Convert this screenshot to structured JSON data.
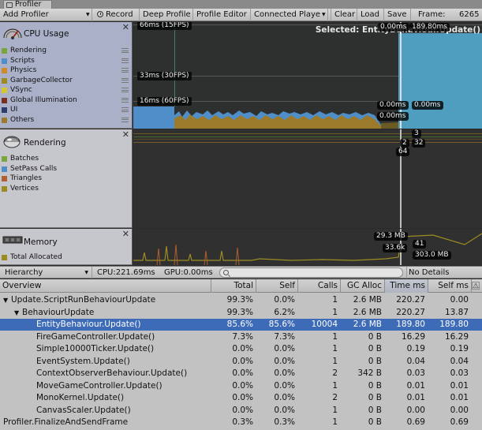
{
  "window": {
    "tab_title": "Profiler"
  },
  "toolbar": {
    "add_profiler": "Add Profiler",
    "record": "Record",
    "deep_profile": "Deep Profile",
    "profile_editor": "Profile Editor",
    "connected_player": "Connected Playe",
    "clear": "Clear",
    "load": "Load",
    "save": "Save",
    "frame_label": "Frame:",
    "frame_value": "6265"
  },
  "cpu_panel": {
    "title": "CPU Usage",
    "icon": "cpu-gauge-icon",
    "items": [
      {
        "label": "Rendering",
        "color": "#7aa53b"
      },
      {
        "label": "Scripts",
        "color": "#4f8ec8"
      },
      {
        "label": "Physics",
        "color": "#d08a2a"
      },
      {
        "label": "GarbageCollector",
        "color": "#9c8c1f"
      },
      {
        "label": "VSync",
        "color": "#d5c52e"
      },
      {
        "label": "Global Illumination",
        "color": "#7a2e1f"
      },
      {
        "label": "UI",
        "color": "#2b3e6b"
      },
      {
        "label": "Others",
        "color": "#9c7a2c"
      }
    ],
    "fps_labels": [
      "66ms (15FPS)",
      "33ms (30FPS)",
      "16ms (60FPS)"
    ],
    "selected_text": "Selected: EntityBehaviour.Update()",
    "value_labels": [
      "0.00ms",
      "189.80ms",
      "0.00ms",
      "0.00ms",
      "0.00ms"
    ]
  },
  "render_panel": {
    "title": "Rendering",
    "icon": "rendering-teapot-icon",
    "items": [
      {
        "label": "Batches",
        "color": "#7aa53b"
      },
      {
        "label": "SetPass Calls",
        "color": "#4f8ec8"
      },
      {
        "label": "Triangles",
        "color": "#b06030"
      },
      {
        "label": "Vertices",
        "color": "#9c8c1f"
      }
    ],
    "value_labels": [
      "3",
      "2",
      "32",
      "64"
    ]
  },
  "memory_panel": {
    "title": "Memory",
    "icon": "memory-chip-icon",
    "items": [
      {
        "label": "Total Allocated",
        "color": "#9c8c1f"
      }
    ],
    "value_labels": [
      "29.3 MB",
      "41",
      "33.6k",
      "303.0 MB"
    ]
  },
  "detail_bar": {
    "view_mode": "Hierarchy",
    "cpu_time": "CPU:221.69ms",
    "gpu_time": "GPU:0.00ms",
    "search_value": "",
    "details_mode": "No Details"
  },
  "table": {
    "columns": [
      "Overview",
      "Total",
      "Self",
      "Calls",
      "GC Alloc",
      "Time ms",
      "Self ms"
    ],
    "sorted_column": "Time ms",
    "rows": [
      {
        "arrow": "▼",
        "name": "Update.ScriptRunBehaviourUpdate",
        "total": "99.3%",
        "self": "0.0%",
        "calls": "1",
        "gc": "2.6 MB",
        "time": "220.27",
        "selfms": "0.00"
      },
      {
        "arrow": "▼",
        "name": "BehaviourUpdate",
        "total": "99.3%",
        "self": "6.2%",
        "calls": "1",
        "gc": "2.6 MB",
        "time": "220.27",
        "selfms": "13.87"
      },
      {
        "arrow": "",
        "name": "EntityBehaviour.Update()",
        "total": "85.6%",
        "self": "85.6%",
        "calls": "10004",
        "gc": "2.6 MB",
        "time": "189.80",
        "selfms": "189.80",
        "selected": true
      },
      {
        "arrow": "",
        "name": "FireGameController.Update()",
        "total": "7.3%",
        "self": "7.3%",
        "calls": "1",
        "gc": "0 B",
        "time": "16.29",
        "selfms": "16.29"
      },
      {
        "arrow": "",
        "name": "Simple10000Ticker.Update()",
        "total": "0.0%",
        "self": "0.0%",
        "calls": "1",
        "gc": "0 B",
        "time": "0.19",
        "selfms": "0.19"
      },
      {
        "arrow": "",
        "name": "EventSystem.Update()",
        "total": "0.0%",
        "self": "0.0%",
        "calls": "1",
        "gc": "0 B",
        "time": "0.04",
        "selfms": "0.04"
      },
      {
        "arrow": "",
        "name": "ContextObserverBehaviour.Update()",
        "total": "0.0%",
        "self": "0.0%",
        "calls": "2",
        "gc": "342 B",
        "time": "0.03",
        "selfms": "0.03"
      },
      {
        "arrow": "",
        "name": "MoveGameController.Update()",
        "total": "0.0%",
        "self": "0.0%",
        "calls": "1",
        "gc": "0 B",
        "time": "0.01",
        "selfms": "0.01"
      },
      {
        "arrow": "",
        "name": "MonoKernel.Update()",
        "total": "0.0%",
        "self": "0.0%",
        "calls": "2",
        "gc": "0 B",
        "time": "0.01",
        "selfms": "0.01"
      },
      {
        "arrow": "",
        "name": "CanvasScaler.Update()",
        "total": "0.0%",
        "self": "0.0%",
        "calls": "1",
        "gc": "0 B",
        "time": "0.00",
        "selfms": "0.00"
      },
      {
        "arrow": "",
        "name": "Profiler.FinalizeAndSendFrame",
        "total": "0.3%",
        "self": "0.3%",
        "calls": "1",
        "gc": "0 B",
        "time": "0.69",
        "selfms": "0.69"
      }
    ]
  }
}
